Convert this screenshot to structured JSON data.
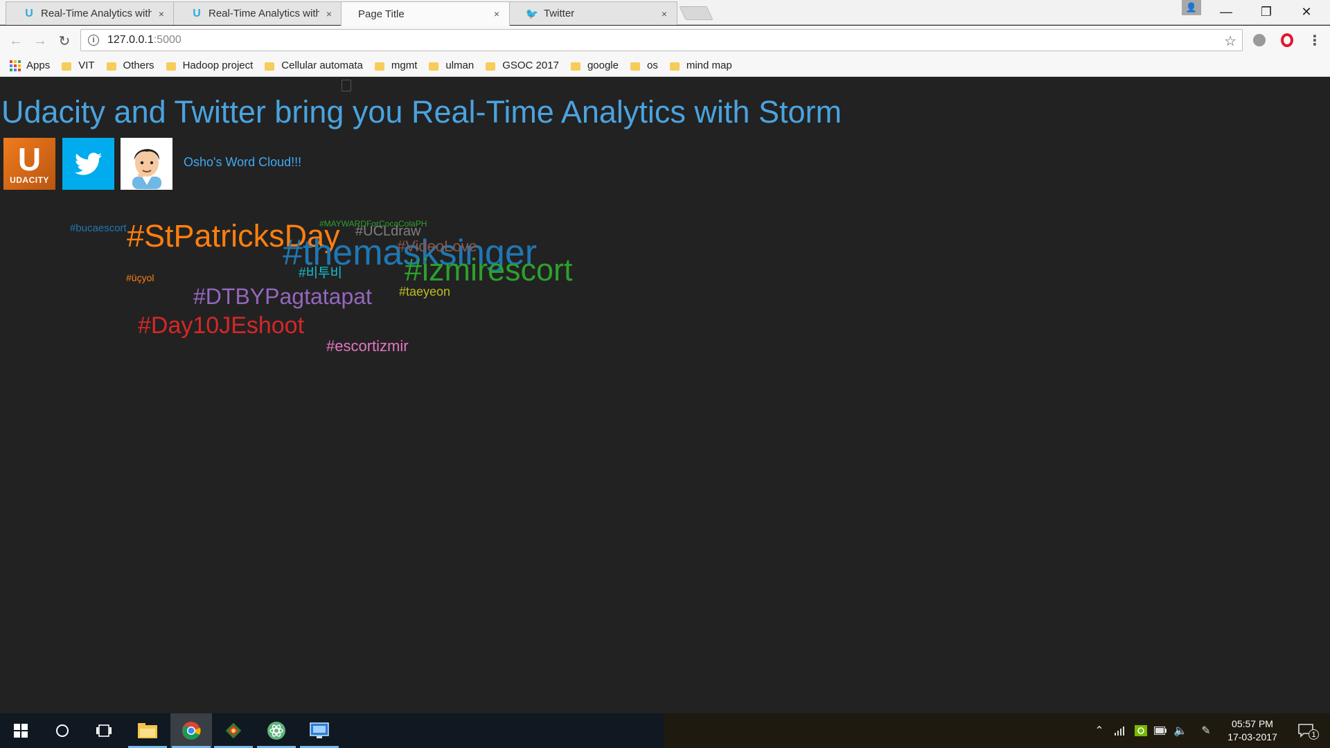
{
  "browser": {
    "tabs": [
      {
        "label": "Real-Time Analytics with",
        "icon": "udacity-icon"
      },
      {
        "label": "Real-Time Analytics with",
        "icon": "udacity-icon"
      },
      {
        "label": "Page Title",
        "icon": "page-icon"
      },
      {
        "label": "Twitter",
        "icon": "twitter-icon"
      }
    ],
    "tab_close_glyph": "×",
    "address": {
      "host": "127.0.0.1",
      "port": ":5000"
    },
    "bookmarks": [
      "Apps",
      "VIT",
      "Others",
      "Hadoop project",
      "Cellular automata",
      "mgmt",
      "ulman",
      "GSOC 2017",
      "google",
      "os",
      "mind map"
    ]
  },
  "page": {
    "title": "Udacity and Twitter bring you Real-Time Analytics with Storm",
    "udacity_logo_text": "UDACITY",
    "word_cloud_link": "Osho's Word Cloud!!!",
    "word_cloud": [
      {
        "text": "#bucaescort",
        "color": "#1f77b4"
      },
      {
        "text": "#StPatricksDay",
        "color": "#ff7f0e"
      },
      {
        "text": "#MAYWARDForCocaColaPH",
        "color": "#2ca02c"
      },
      {
        "text": "#UCLdraw",
        "color": "#7f7f7f"
      },
      {
        "text": "#themasksinger",
        "color": "#1f77b4"
      },
      {
        "text": "#VideoLove",
        "color": "#8c564b"
      },
      {
        "text": "#izmirescort",
        "color": "#2ca02c"
      },
      {
        "text": "#üçyol",
        "color": "#ff7f0e"
      },
      {
        "text": "#비투비",
        "color": "#17becf"
      },
      {
        "text": "#taeyeon",
        "color": "#bcbd22"
      },
      {
        "text": "#DTBYPagtatapat",
        "color": "#9467bd"
      },
      {
        "text": "#Day10JEshoot",
        "color": "#d62728"
      },
      {
        "text": "#escortizmir",
        "color": "#e377c2"
      }
    ]
  },
  "taskbar": {
    "time": "05:57 PM",
    "date": "17-03-2017",
    "notification_count": "1"
  }
}
